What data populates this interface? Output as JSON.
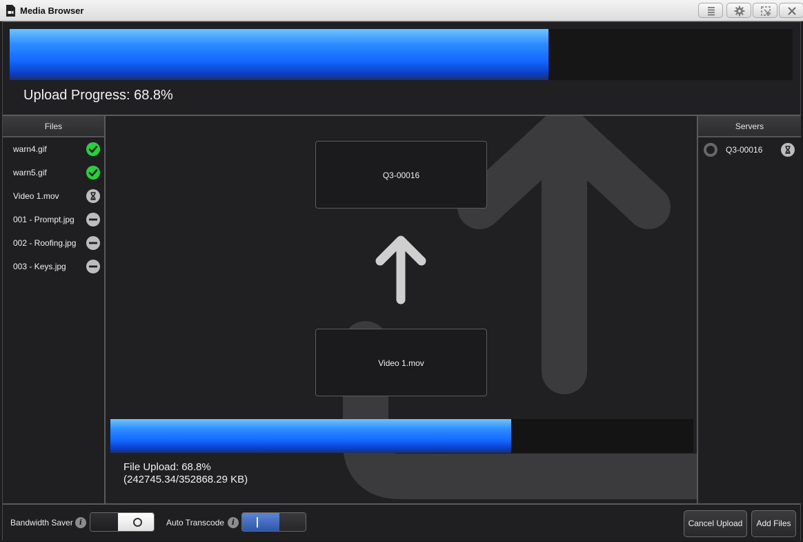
{
  "window": {
    "title": "Media Browser",
    "controls": [
      "menu-icon",
      "gear-icon",
      "popout-icon",
      "close-icon"
    ]
  },
  "upload": {
    "progress": 0.688,
    "label": "Upload Progress: 68.8%"
  },
  "files_panel": {
    "header": "Files",
    "items": [
      {
        "name": "warn4.gif",
        "status": "complete",
        "icon": "check-icon"
      },
      {
        "name": "warn5.gif",
        "status": "complete",
        "icon": "check-icon"
      },
      {
        "name": "Video 1.mov",
        "status": "in-progress",
        "icon": "hourglass-icon"
      },
      {
        "name": "001 - Prompt.jpg",
        "status": "pending",
        "icon": "minus-icon"
      },
      {
        "name": "002 - Roofing.jpg",
        "status": "pending",
        "icon": "minus-icon"
      },
      {
        "name": "003 - Keys.jpg",
        "status": "pending",
        "icon": "minus-icon"
      }
    ]
  },
  "transfer": {
    "destination": "Q3-00016",
    "source": "Video 1.mov",
    "file_progress": 0.688,
    "file_label": "File Upload: 68.8%",
    "file_size_label": "(242745.34/352868.29 KB)"
  },
  "servers_panel": {
    "header": "Servers",
    "items": [
      {
        "name": "Q3-00016",
        "status": "in-progress",
        "icon": "hourglass-icon"
      }
    ]
  },
  "options": {
    "bandwidth_saver": {
      "label": "Bandwidth Saver",
      "on": false
    },
    "auto_transcode": {
      "label": "Auto Transcode",
      "on": true
    }
  },
  "actions": {
    "cancel_label": "Cancel Upload",
    "add_label": "Add Files"
  },
  "colors": {
    "progress_fill": "#1469ff",
    "success": "#22d435",
    "icon_gray": "#bdbdbd",
    "toggle_on": "#3c62b0"
  }
}
